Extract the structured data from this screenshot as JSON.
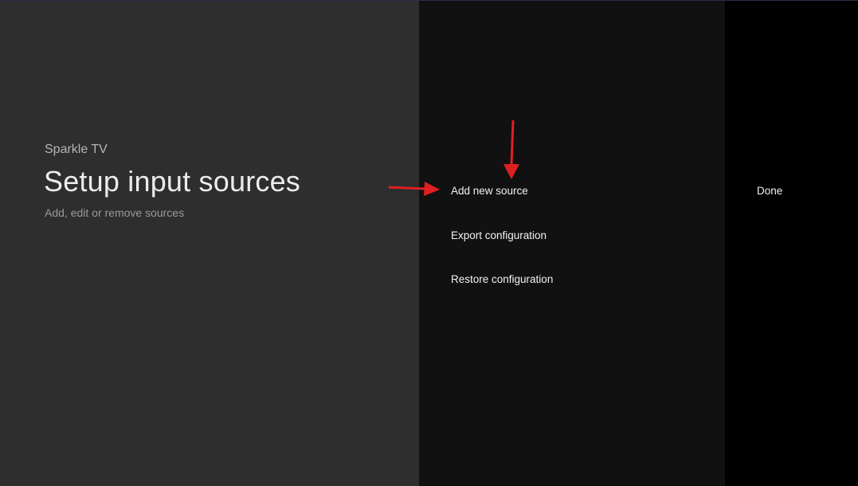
{
  "header": {
    "brand": "Sparkle TV",
    "title": "Setup input sources",
    "subtitle": "Add, edit or remove sources"
  },
  "menu": {
    "items": [
      {
        "label": "Add new source"
      },
      {
        "label": "Export configuration"
      },
      {
        "label": "Restore configuration"
      }
    ]
  },
  "actions": {
    "done_label": "Done"
  },
  "annotations": {
    "arrow_color": "#e02020",
    "arrow_icons": [
      "arrow-right-icon",
      "arrow-down-icon"
    ]
  },
  "colors": {
    "left_panel": "#2e2e2e",
    "middle_panel": "#111111",
    "right_panel": "#000000"
  }
}
